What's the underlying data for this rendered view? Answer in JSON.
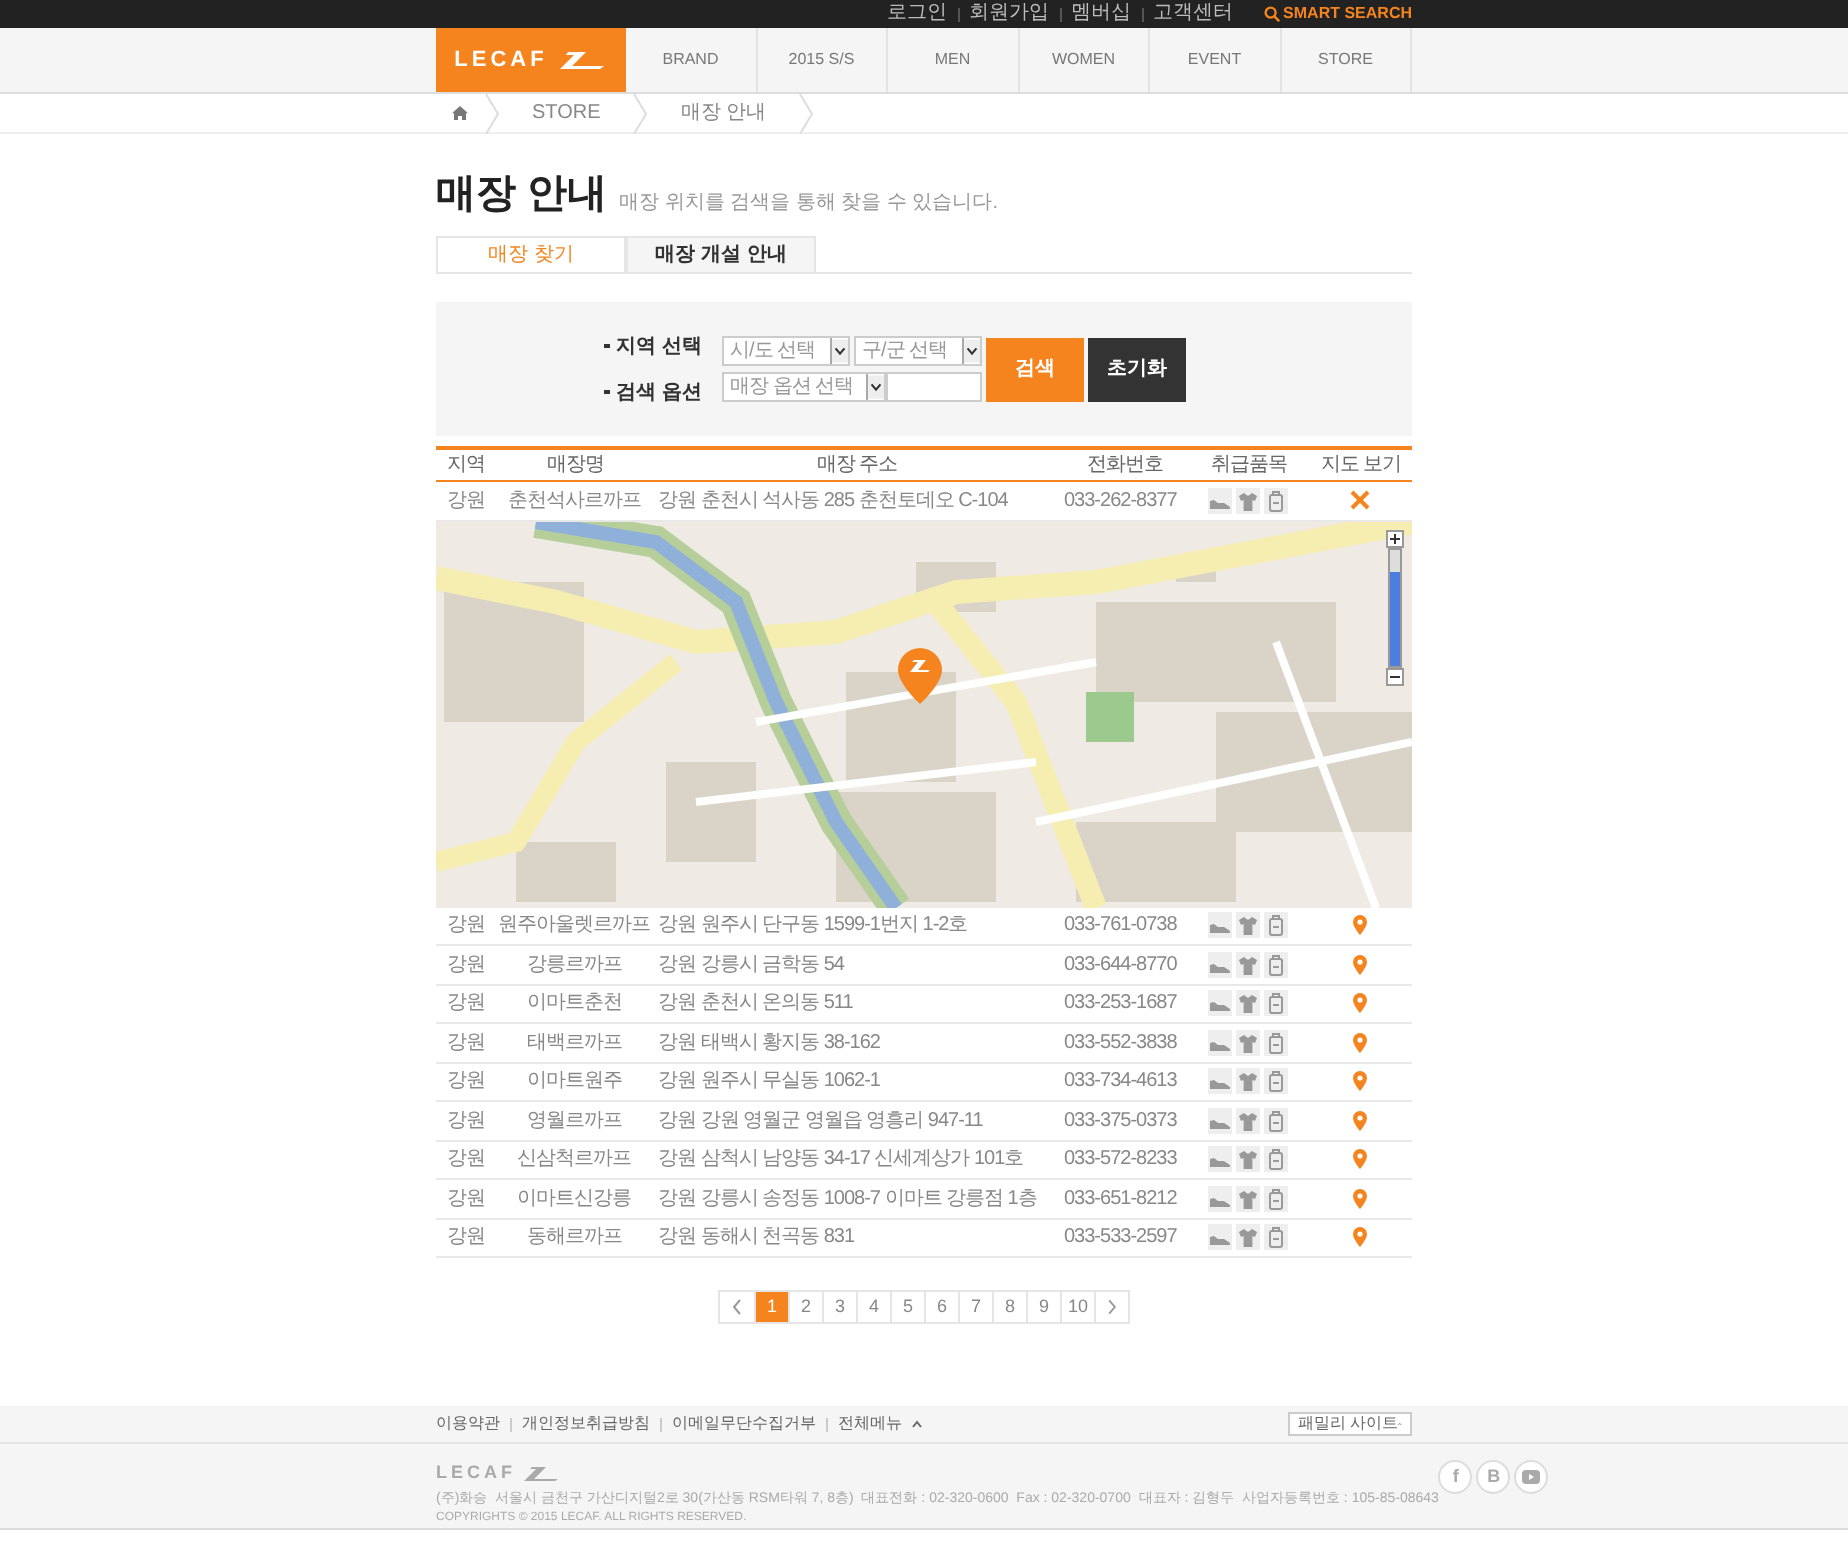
{
  "top_links": [
    "로그인",
    "회원가입",
    "멤버십",
    "고객센터"
  ],
  "smart_search": "SMART SEARCH",
  "logo": "LECAF",
  "nav": [
    "BRAND",
    "2015 S/S",
    "MEN",
    "WOMEN",
    "EVENT",
    "STORE"
  ],
  "breadcrumb": [
    "STORE",
    "매장 안내"
  ],
  "page_title": "매장 안내",
  "page_subtitle": "매장 위치를 검색을 통해 찾을 수 있습니다.",
  "tabs": [
    {
      "label": "매장 찾기",
      "selected": true
    },
    {
      "label": "매장 개설 안내",
      "selected": false
    }
  ],
  "search": {
    "region_label": "지역 선택",
    "option_label": "검색 옵션",
    "province_select": "시/도 선택",
    "district_select": "구/군 선택",
    "option_select": "매장 옵션 선택",
    "search_button": "검색",
    "reset_button": "초기화"
  },
  "table": {
    "columns": [
      "지역",
      "매장명",
      "매장 주소",
      "전화번호",
      "취급품목",
      "지도 보기"
    ],
    "rows": [
      {
        "region": "강원",
        "name": "춘천석사르까프",
        "address": "강원 춘천시 석사동 285 춘천토데오 C-104",
        "phone": "033-262-8377",
        "expanded": true
      },
      {
        "region": "강원",
        "name": "원주아울렛르까프",
        "address": "강원 원주시 단구동 1599-1번지 1-2호",
        "phone": "033-761-0738",
        "expanded": false
      },
      {
        "region": "강원",
        "name": "강릉르까프",
        "address": "강원 강릉시 금학동 54",
        "phone": "033-644-8770",
        "expanded": false
      },
      {
        "region": "강원",
        "name": "이마트춘천",
        "address": "강원 춘천시 온의동 511",
        "phone": "033-253-1687",
        "expanded": false
      },
      {
        "region": "강원",
        "name": "태백르까프",
        "address": "강원 태백시 황지동 38-162",
        "phone": "033-552-3838",
        "expanded": false
      },
      {
        "region": "강원",
        "name": "이마트원주",
        "address": "강원 원주시 무실동 1062-1",
        "phone": "033-734-4613",
        "expanded": false
      },
      {
        "region": "강원",
        "name": "영월르까프",
        "address": "강원 강원 영월군 영월읍 영흥리 947-11",
        "phone": "033-375-0373",
        "expanded": false
      },
      {
        "region": "강원",
        "name": "신삼척르까프",
        "address": "강원 삼척시 남양동 34-17 신세계상가 101호",
        "phone": "033-572-8233",
        "expanded": false
      },
      {
        "region": "강원",
        "name": "이마트신강릉",
        "address": "강원 강릉시 송정동 1008-7 이마트 강릉점 1층",
        "phone": "033-651-8212",
        "expanded": false
      },
      {
        "region": "강원",
        "name": "동해르까프",
        "address": "강원 동해시 천곡동 831",
        "phone": "033-533-2597",
        "expanded": false
      }
    ]
  },
  "map": {
    "zoom": {
      "level": 0.8
    }
  },
  "pagination": [
    {
      "label": "1",
      "selected": true
    },
    {
      "label": "2",
      "selected": false
    },
    {
      "label": "3",
      "selected": false
    },
    {
      "label": "4",
      "selected": false
    },
    {
      "label": "5",
      "selected": false
    },
    {
      "label": "6",
      "selected": false
    },
    {
      "label": "7",
      "selected": false
    },
    {
      "label": "8",
      "selected": false
    },
    {
      "label": "9",
      "selected": false
    },
    {
      "label": "10",
      "selected": false
    }
  ],
  "footer": {
    "links": [
      "이용약관",
      "개인정보취급방침",
      "이메일무단수집거부",
      "전체메뉴"
    ],
    "family_site": "패밀리 사이트",
    "logo": "LECAF",
    "address": "(주)화승  서울시 금천구 가산디지털2로 30(가산동 RSM타워 7, 8층)  대표전화 : 02-320-0600  Fax : 02-320-0700  대표자 : 김형두  사업자등록번호 : 105-85-08643",
    "copyright": "COPYRIGHTS © 2015 LECAF. ALL RIGHTS RESERVED.",
    "social": [
      "f",
      "B"
    ]
  }
}
